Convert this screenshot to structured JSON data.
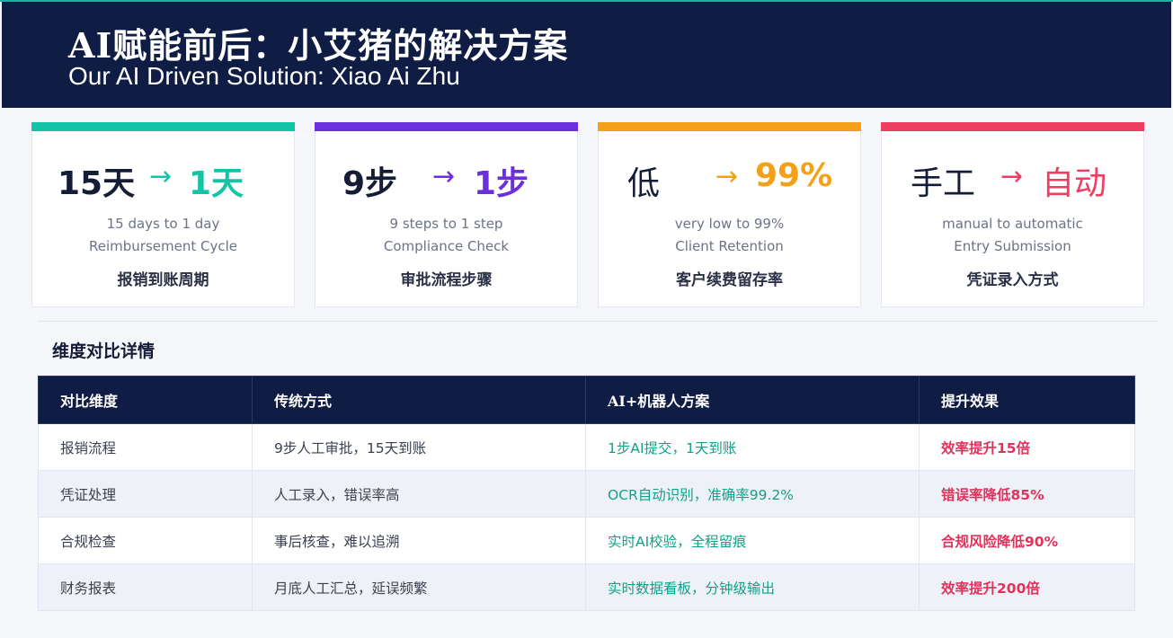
{
  "header": {
    "title_zh": "AI赋能前后：小艾猪的解决方案",
    "title_en": "Our AI Driven Solution: Xiao Ai Zhu"
  },
  "cards": [
    {
      "accent": "#14c4a6",
      "from": "15天",
      "arrow": "→",
      "to": "1天",
      "to_color": "#14c4a6",
      "en1": "15 days to 1 day",
      "en2": "Reimbursement Cycle",
      "zh": "报销到账周期"
    },
    {
      "accent": "#6b2fdd",
      "from": "9步",
      "arrow": "→",
      "to": "1步",
      "to_color": "#6b2fdd",
      "en1": "9 steps to 1 step",
      "en2": "Compliance Check",
      "zh": "审批流程步骤"
    },
    {
      "accent": "#f4a019",
      "from": "低",
      "arrow": "→",
      "to": "99%",
      "to_color": "#f4a019",
      "en1": "very low to 99%",
      "en2": "Client Retention",
      "zh": "客户续费留存率"
    },
    {
      "accent": "#ee3e62",
      "from": "手工",
      "arrow": "→",
      "to": "自动",
      "to_color": "#ee3e62",
      "en1": "manual to automatic",
      "en2": "Entry Submission",
      "zh": "凭证录入方式"
    }
  ],
  "section": {
    "title": "维度对比详情"
  },
  "table": {
    "headers": [
      "对比维度",
      "传统方式",
      "AI+机器人方案",
      "提升效果"
    ],
    "rows": [
      [
        "报销流程",
        "9步人工审批，15天到账",
        "1步AI提交，1天到账",
        "效率提升15倍"
      ],
      [
        "凭证处理",
        "人工录入，错误率高",
        "OCR自动识别，准确率99.2%",
        "错误率降低85%"
      ],
      [
        "合规检查",
        "事后核查，难以追溯",
        "实时AI校验，全程留痕",
        "合规风险降低90%"
      ],
      [
        "财务报表",
        "月底人工汇总，延误频繁",
        "实时数据看板，分钟级输出",
        "效率提升200倍"
      ]
    ]
  },
  "colors": {
    "navy": "#0f1c44",
    "teal": "#13a08a",
    "red": "#e0325a"
  }
}
